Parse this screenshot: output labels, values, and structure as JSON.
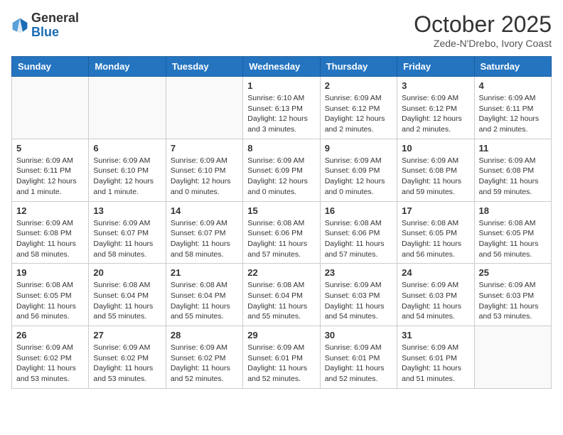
{
  "header": {
    "logo_general": "General",
    "logo_blue": "Blue",
    "month_year": "October 2025",
    "location": "Zede-N'Drebo, Ivory Coast"
  },
  "weekdays": [
    "Sunday",
    "Monday",
    "Tuesday",
    "Wednesday",
    "Thursday",
    "Friday",
    "Saturday"
  ],
  "weeks": [
    [
      {
        "day": "",
        "info": ""
      },
      {
        "day": "",
        "info": ""
      },
      {
        "day": "",
        "info": ""
      },
      {
        "day": "1",
        "info": "Sunrise: 6:10 AM\nSunset: 6:13 PM\nDaylight: 12 hours and 3 minutes."
      },
      {
        "day": "2",
        "info": "Sunrise: 6:09 AM\nSunset: 6:12 PM\nDaylight: 12 hours and 2 minutes."
      },
      {
        "day": "3",
        "info": "Sunrise: 6:09 AM\nSunset: 6:12 PM\nDaylight: 12 hours and 2 minutes."
      },
      {
        "day": "4",
        "info": "Sunrise: 6:09 AM\nSunset: 6:11 PM\nDaylight: 12 hours and 2 minutes."
      }
    ],
    [
      {
        "day": "5",
        "info": "Sunrise: 6:09 AM\nSunset: 6:11 PM\nDaylight: 12 hours and 1 minute."
      },
      {
        "day": "6",
        "info": "Sunrise: 6:09 AM\nSunset: 6:10 PM\nDaylight: 12 hours and 1 minute."
      },
      {
        "day": "7",
        "info": "Sunrise: 6:09 AM\nSunset: 6:10 PM\nDaylight: 12 hours and 0 minutes."
      },
      {
        "day": "8",
        "info": "Sunrise: 6:09 AM\nSunset: 6:09 PM\nDaylight: 12 hours and 0 minutes."
      },
      {
        "day": "9",
        "info": "Sunrise: 6:09 AM\nSunset: 6:09 PM\nDaylight: 12 hours and 0 minutes."
      },
      {
        "day": "10",
        "info": "Sunrise: 6:09 AM\nSunset: 6:08 PM\nDaylight: 11 hours and 59 minutes."
      },
      {
        "day": "11",
        "info": "Sunrise: 6:09 AM\nSunset: 6:08 PM\nDaylight: 11 hours and 59 minutes."
      }
    ],
    [
      {
        "day": "12",
        "info": "Sunrise: 6:09 AM\nSunset: 6:08 PM\nDaylight: 11 hours and 58 minutes."
      },
      {
        "day": "13",
        "info": "Sunrise: 6:09 AM\nSunset: 6:07 PM\nDaylight: 11 hours and 58 minutes."
      },
      {
        "day": "14",
        "info": "Sunrise: 6:09 AM\nSunset: 6:07 PM\nDaylight: 11 hours and 58 minutes."
      },
      {
        "day": "15",
        "info": "Sunrise: 6:08 AM\nSunset: 6:06 PM\nDaylight: 11 hours and 57 minutes."
      },
      {
        "day": "16",
        "info": "Sunrise: 6:08 AM\nSunset: 6:06 PM\nDaylight: 11 hours and 57 minutes."
      },
      {
        "day": "17",
        "info": "Sunrise: 6:08 AM\nSunset: 6:05 PM\nDaylight: 11 hours and 56 minutes."
      },
      {
        "day": "18",
        "info": "Sunrise: 6:08 AM\nSunset: 6:05 PM\nDaylight: 11 hours and 56 minutes."
      }
    ],
    [
      {
        "day": "19",
        "info": "Sunrise: 6:08 AM\nSunset: 6:05 PM\nDaylight: 11 hours and 56 minutes."
      },
      {
        "day": "20",
        "info": "Sunrise: 6:08 AM\nSunset: 6:04 PM\nDaylight: 11 hours and 55 minutes."
      },
      {
        "day": "21",
        "info": "Sunrise: 6:08 AM\nSunset: 6:04 PM\nDaylight: 11 hours and 55 minutes."
      },
      {
        "day": "22",
        "info": "Sunrise: 6:08 AM\nSunset: 6:04 PM\nDaylight: 11 hours and 55 minutes."
      },
      {
        "day": "23",
        "info": "Sunrise: 6:09 AM\nSunset: 6:03 PM\nDaylight: 11 hours and 54 minutes."
      },
      {
        "day": "24",
        "info": "Sunrise: 6:09 AM\nSunset: 6:03 PM\nDaylight: 11 hours and 54 minutes."
      },
      {
        "day": "25",
        "info": "Sunrise: 6:09 AM\nSunset: 6:03 PM\nDaylight: 11 hours and 53 minutes."
      }
    ],
    [
      {
        "day": "26",
        "info": "Sunrise: 6:09 AM\nSunset: 6:02 PM\nDaylight: 11 hours and 53 minutes."
      },
      {
        "day": "27",
        "info": "Sunrise: 6:09 AM\nSunset: 6:02 PM\nDaylight: 11 hours and 53 minutes."
      },
      {
        "day": "28",
        "info": "Sunrise: 6:09 AM\nSunset: 6:02 PM\nDaylight: 11 hours and 52 minutes."
      },
      {
        "day": "29",
        "info": "Sunrise: 6:09 AM\nSunset: 6:01 PM\nDaylight: 11 hours and 52 minutes."
      },
      {
        "day": "30",
        "info": "Sunrise: 6:09 AM\nSunset: 6:01 PM\nDaylight: 11 hours and 52 minutes."
      },
      {
        "day": "31",
        "info": "Sunrise: 6:09 AM\nSunset: 6:01 PM\nDaylight: 11 hours and 51 minutes."
      },
      {
        "day": "",
        "info": ""
      }
    ]
  ]
}
